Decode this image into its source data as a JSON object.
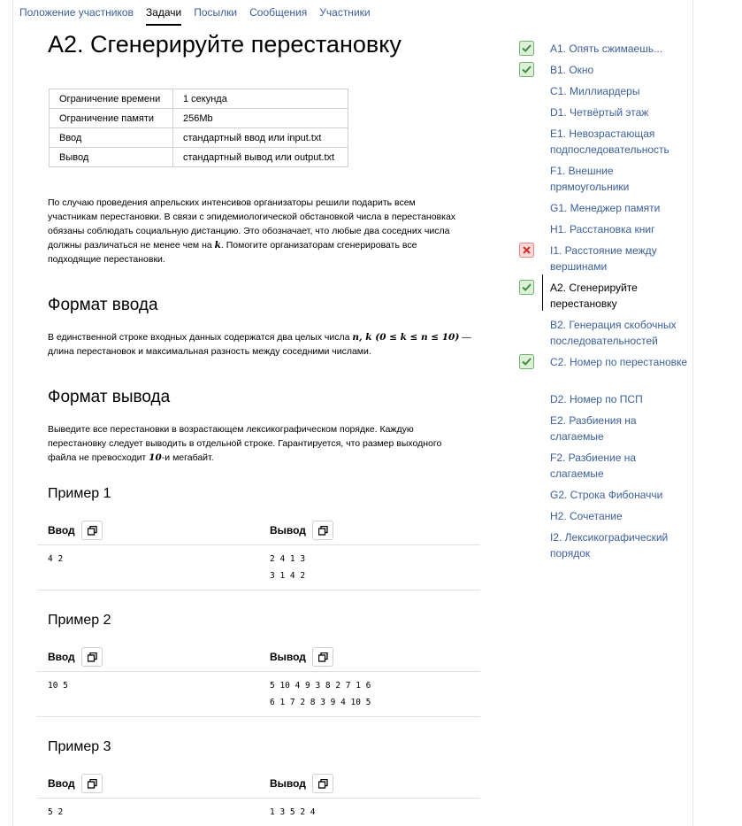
{
  "nav": {
    "items": [
      "Положение участников",
      "Задачи",
      "Посылки",
      "Сообщения",
      "Участники"
    ]
  },
  "title": "A2. Сгенерируйте перестановку",
  "limits": [
    {
      "key": "Ограничение времени",
      "value": "1 секунда"
    },
    {
      "key": "Ограничение памяти",
      "value": "256Mb"
    },
    {
      "key": "Ввод",
      "value": "стандартный ввод или input.txt"
    },
    {
      "key": "Вывод",
      "value": "стандартный вывод или output.txt"
    }
  ],
  "statement": {
    "line1": "По случаю проведения апрельских интенсивов организаторы решили подарить всем",
    "line2": "участникам перестановки. В связи с эпидемиологической обстановкой числа в перестановках",
    "line3": "обязаны соблюдать социальную дистанцию. Это обозначает, что любые два соседних числа",
    "line4_pre": "должны различаться не менее чем на ",
    "line4_math": "k",
    "line4_post": ". Помогите организаторам сгенерировать все",
    "line5": "подходящие перестановки."
  },
  "input_format": {
    "heading": "Формат ввода",
    "line1_pre": "В единственной строке входных данных содержатся два целых числа ",
    "line1_math": "n, k (0 ≤ k ≤ n ≤ 10)",
    "line1_post": " —",
    "line2": "длина перестановок и максимальная разность между соседними числами."
  },
  "output_format": {
    "heading": "Формат вывода",
    "line1": "Выведите все перестановки в возрастающем лексикографическом порядке. Каждую",
    "line2": "перестановку следует выводить в отдельной строке. Гарантируется, что размер выходного",
    "line3_pre": "файла не превосходит ",
    "line3_math": "10",
    "line3_post": "-и мегабайт."
  },
  "examples": [
    {
      "title": "Пример 1",
      "input_label": "Ввод",
      "output_label": "Вывод",
      "input": "4 2",
      "output": "2 4 1 3\n3 1 4 2"
    },
    {
      "title": "Пример 2",
      "input_label": "Ввод",
      "output_label": "Вывод",
      "input": "10 5",
      "output": "5 10 4 9 3 8 2 7 1 6\n6 1 7 2 8 3 9 4 10 5"
    },
    {
      "title": "Пример 3",
      "input_label": "Ввод",
      "output_label": "Вывод",
      "input": "5 2",
      "output": "1 3 5 2 4"
    }
  ],
  "sidebar": {
    "items": [
      {
        "label": "A1. Опять сжимаешь...",
        "status": "ok"
      },
      {
        "label": "B1. Окно",
        "status": "ok"
      },
      {
        "label": "C1. Миллиардеры",
        "status": "none"
      },
      {
        "label": "D1. Четвёртый этаж",
        "status": "none"
      },
      {
        "label": "E1. Невозрастающая подпоследовательность",
        "status": "none"
      },
      {
        "label": "F1. Внешние прямоугольники",
        "status": "none"
      },
      {
        "label": "G1. Менеджер памяти",
        "status": "none"
      },
      {
        "label": "H1. Расстановка книг",
        "status": "none"
      },
      {
        "label": "I1. Расстояние между вершинами",
        "status": "fail"
      },
      {
        "label": "A2. Сгенерируйте перестановку",
        "status": "ok"
      },
      {
        "label": "B2. Генерация скобочных последовательностей",
        "status": "none"
      },
      {
        "label": "C2. Номер по перестановке",
        "status": "ok"
      },
      {
        "label": "D2. Номер по ПСП",
        "status": "none"
      },
      {
        "label": "E2. Разбиения на слагаемые",
        "status": "none"
      },
      {
        "label": "F2. Разбиение на слагаемые",
        "status": "none"
      },
      {
        "label": "G2. Строка Фибоначчи",
        "status": "none"
      },
      {
        "label": "H2. Сочетание",
        "status": "none"
      },
      {
        "label": "I2. Лексикографический порядок",
        "status": "none"
      }
    ]
  },
  "colors": {
    "link": "#3b5f9c",
    "ok": "#4caf50",
    "fail": "#e53935"
  }
}
